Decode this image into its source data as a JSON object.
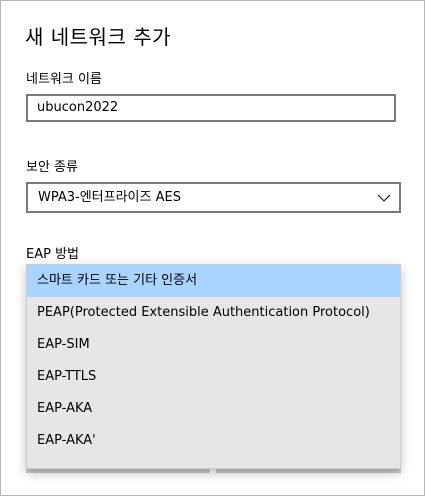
{
  "dialog": {
    "title": "새 네트워크 추가",
    "network_name_label": "네트워크 이름",
    "network_name_value": "ubucon2022",
    "security_type_label": "보안 종류",
    "security_type_value": "WPA3-엔터프라이즈 AES",
    "eap_method_label": "EAP 방법"
  },
  "eap_options": [
    {
      "label": "스마트 카드 또는 기타 인증서",
      "selected": true
    },
    {
      "label": "PEAP(Protected Extensible Authentication Protocol)",
      "selected": false
    },
    {
      "label": "EAP-SIM",
      "selected": false
    },
    {
      "label": "EAP-TTLS",
      "selected": false
    },
    {
      "label": "EAP-AKA",
      "selected": false
    },
    {
      "label": "EAP-AKA'",
      "selected": false
    }
  ],
  "colors": {
    "selected_highlight": "#a9d4ff",
    "dropdown_background": "#e6e6e6",
    "input_border": "#7a7a7a"
  },
  "icons": {
    "combo_arrow": "chevron-down-icon"
  }
}
